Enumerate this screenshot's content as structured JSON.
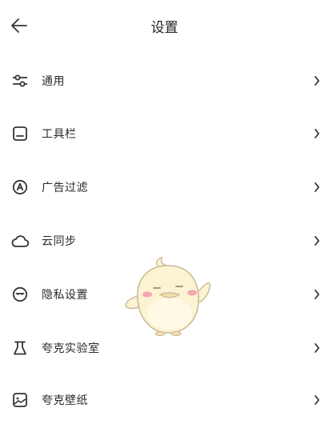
{
  "header": {
    "back_icon": "arrow-left-icon",
    "title": "设置"
  },
  "menu": {
    "items": [
      {
        "label": "通用",
        "icon": "sliders-icon"
      },
      {
        "label": "工具栏",
        "icon": "toolbar-icon"
      },
      {
        "label": "广告过滤",
        "icon": "ad-filter-icon"
      },
      {
        "label": "云同步",
        "icon": "cloud-icon"
      },
      {
        "label": "隐私设置",
        "icon": "privacy-icon"
      },
      {
        "label": "夸克实验室",
        "icon": "flask-icon"
      },
      {
        "label": "夸克壁纸",
        "icon": "wallpaper-icon"
      }
    ],
    "chevron_icon": "chevron-right-icon"
  },
  "mascot": {
    "icon": "duck-mascot-icon",
    "body_color": "#fbf3d2",
    "outline_color": "#c9b89a",
    "cheek_color": "#f4a6b0"
  }
}
